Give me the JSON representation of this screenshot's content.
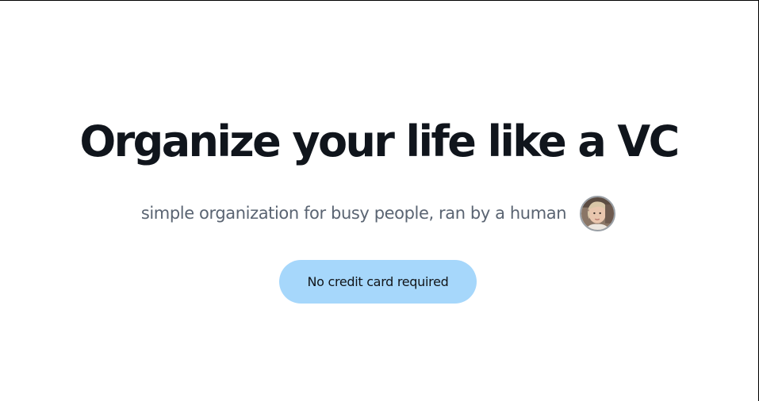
{
  "hero": {
    "title": "Organize your life like a VC",
    "subtitle": "simple organization for busy people, ran by a human",
    "avatar_icon": "person-photo-avatar",
    "cta_label": "No credit card required"
  },
  "colors": {
    "title": "#10151c",
    "subtitle": "#5a6472",
    "button_background": "#a6d7fb",
    "button_text": "#111418",
    "page_background": "#ffffff"
  }
}
